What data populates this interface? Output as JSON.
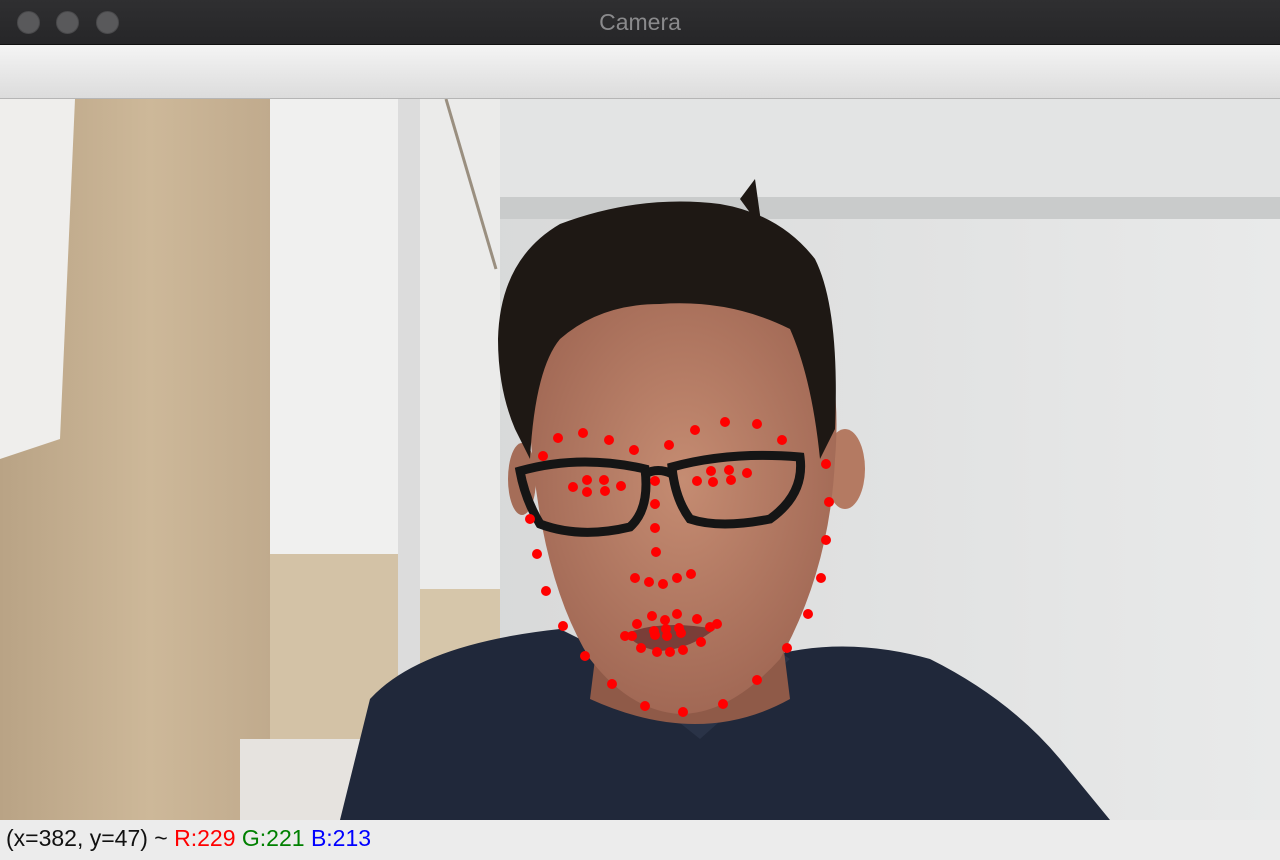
{
  "window": {
    "title": "Camera",
    "buttons": [
      "close",
      "minimize",
      "zoom"
    ]
  },
  "camera_view": {
    "description_icon": "camera-feed",
    "landmark_color": "#ff0000"
  },
  "status": {
    "coords": "(x=382, y=47) ~ ",
    "r_label": "R:229",
    "g_label": "G:221",
    "b_label": "B:213",
    "r_color": "#ff0000",
    "g_color": "#008000",
    "b_color": "#0000ff"
  }
}
